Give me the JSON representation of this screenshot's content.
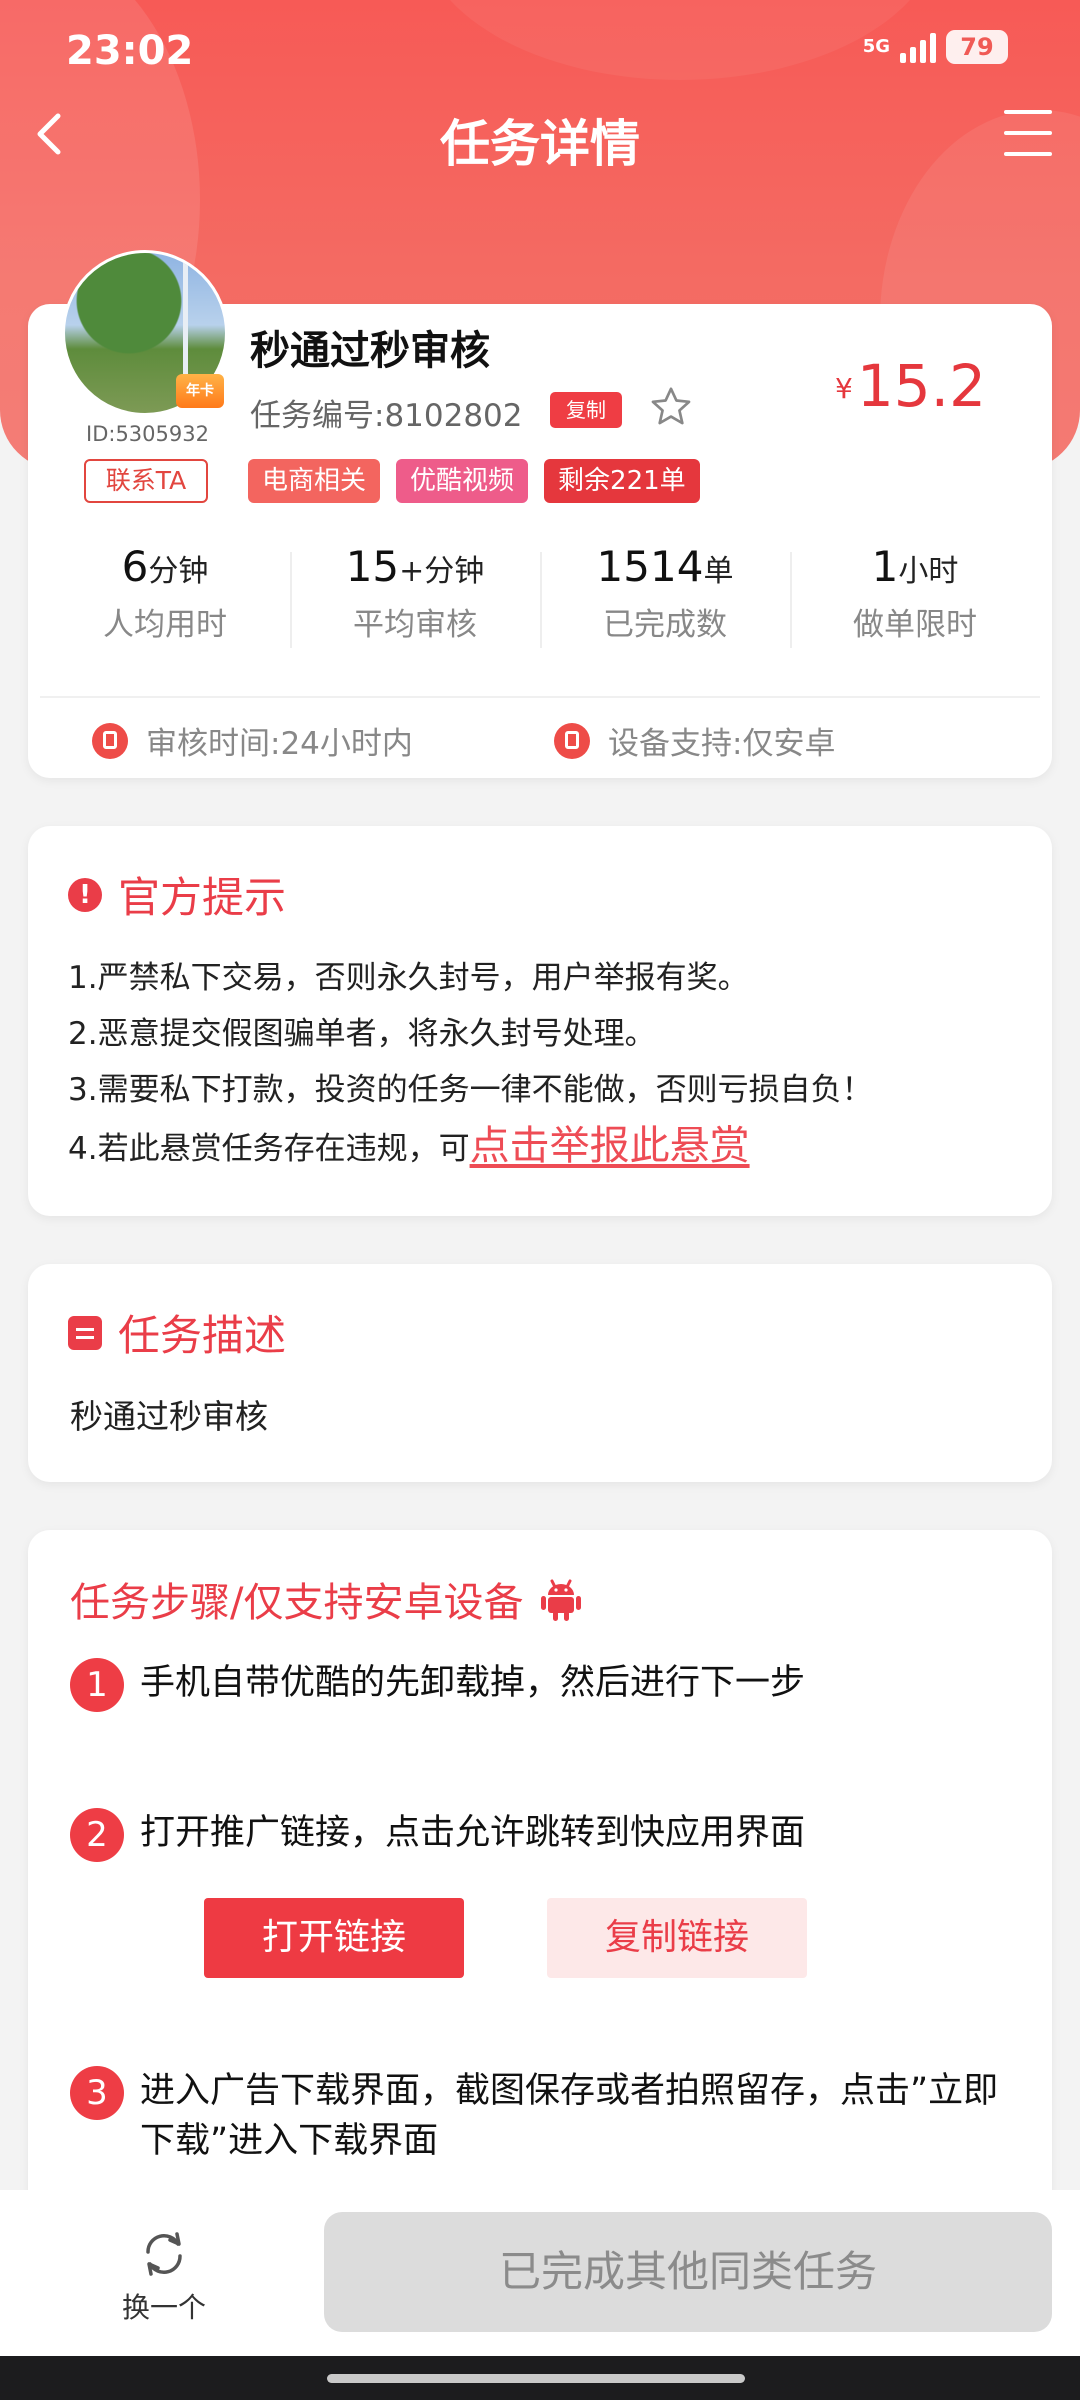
{
  "status_bar": {
    "time": "23:02",
    "network": "5G",
    "battery": "79"
  },
  "nav": {
    "title": "任务详情"
  },
  "task": {
    "title": "秒通过秒审核",
    "task_no": "任务编号:8102802",
    "copy_label": "复制",
    "price_symbol": "¥",
    "price": "15.2",
    "user_id": "ID:5305932",
    "badge": "年卡",
    "contact_label": "联系TA",
    "tags": [
      {
        "label": "电商相关",
        "color": "#f3655f"
      },
      {
        "label": "优酷视频",
        "color": "#ee5c8a"
      },
      {
        "label": "剩余221单",
        "color": "#e5373d"
      }
    ],
    "stats": [
      {
        "value": "6",
        "unit": "分钟",
        "label": "人均用时"
      },
      {
        "value": "15",
        "unit": "+分钟",
        "label": "平均审核"
      },
      {
        "value": "1514",
        "unit": "单",
        "label": "已完成数"
      },
      {
        "value": "1",
        "unit": "小时",
        "label": "做单限时"
      }
    ],
    "review_time": "审核时间:24小时内",
    "device_support": "设备支持:仅安卓"
  },
  "notice": {
    "title": "官方提示",
    "items": [
      "1.严禁私下交易，否则永久封号，用户举报有奖。",
      "2.恶意提交假图骗单者，将永久封号处理。",
      "3.需要私下打款，投资的任务一律不能做，否则亏损自负！"
    ],
    "item4_prefix": "4.若此悬赏任务存在违规，可",
    "report_link": "点击举报此悬赏"
  },
  "description": {
    "title": "任务描述",
    "text": "秒通过秒审核"
  },
  "steps": {
    "title": "任务步骤/仅支持安卓设备",
    "items": [
      {
        "num": "1",
        "text": "手机自带优酷的先卸载掉，然后进行下一步"
      },
      {
        "num": "2",
        "text": "打开推广链接，点击允许跳转到快应用界面"
      },
      {
        "num": "3",
        "text": "进入广告下载界面，截图保存或者拍照留存，点击”立即下载”进入下载界面"
      }
    ],
    "open_link_label": "打开链接",
    "copy_link_label": "复制链接"
  },
  "bottom": {
    "swap_label": "换一个",
    "done_label": "已完成其他同类任务"
  },
  "colors": {
    "brand_red": "#ea3d48",
    "header_red": "#f75a56"
  }
}
